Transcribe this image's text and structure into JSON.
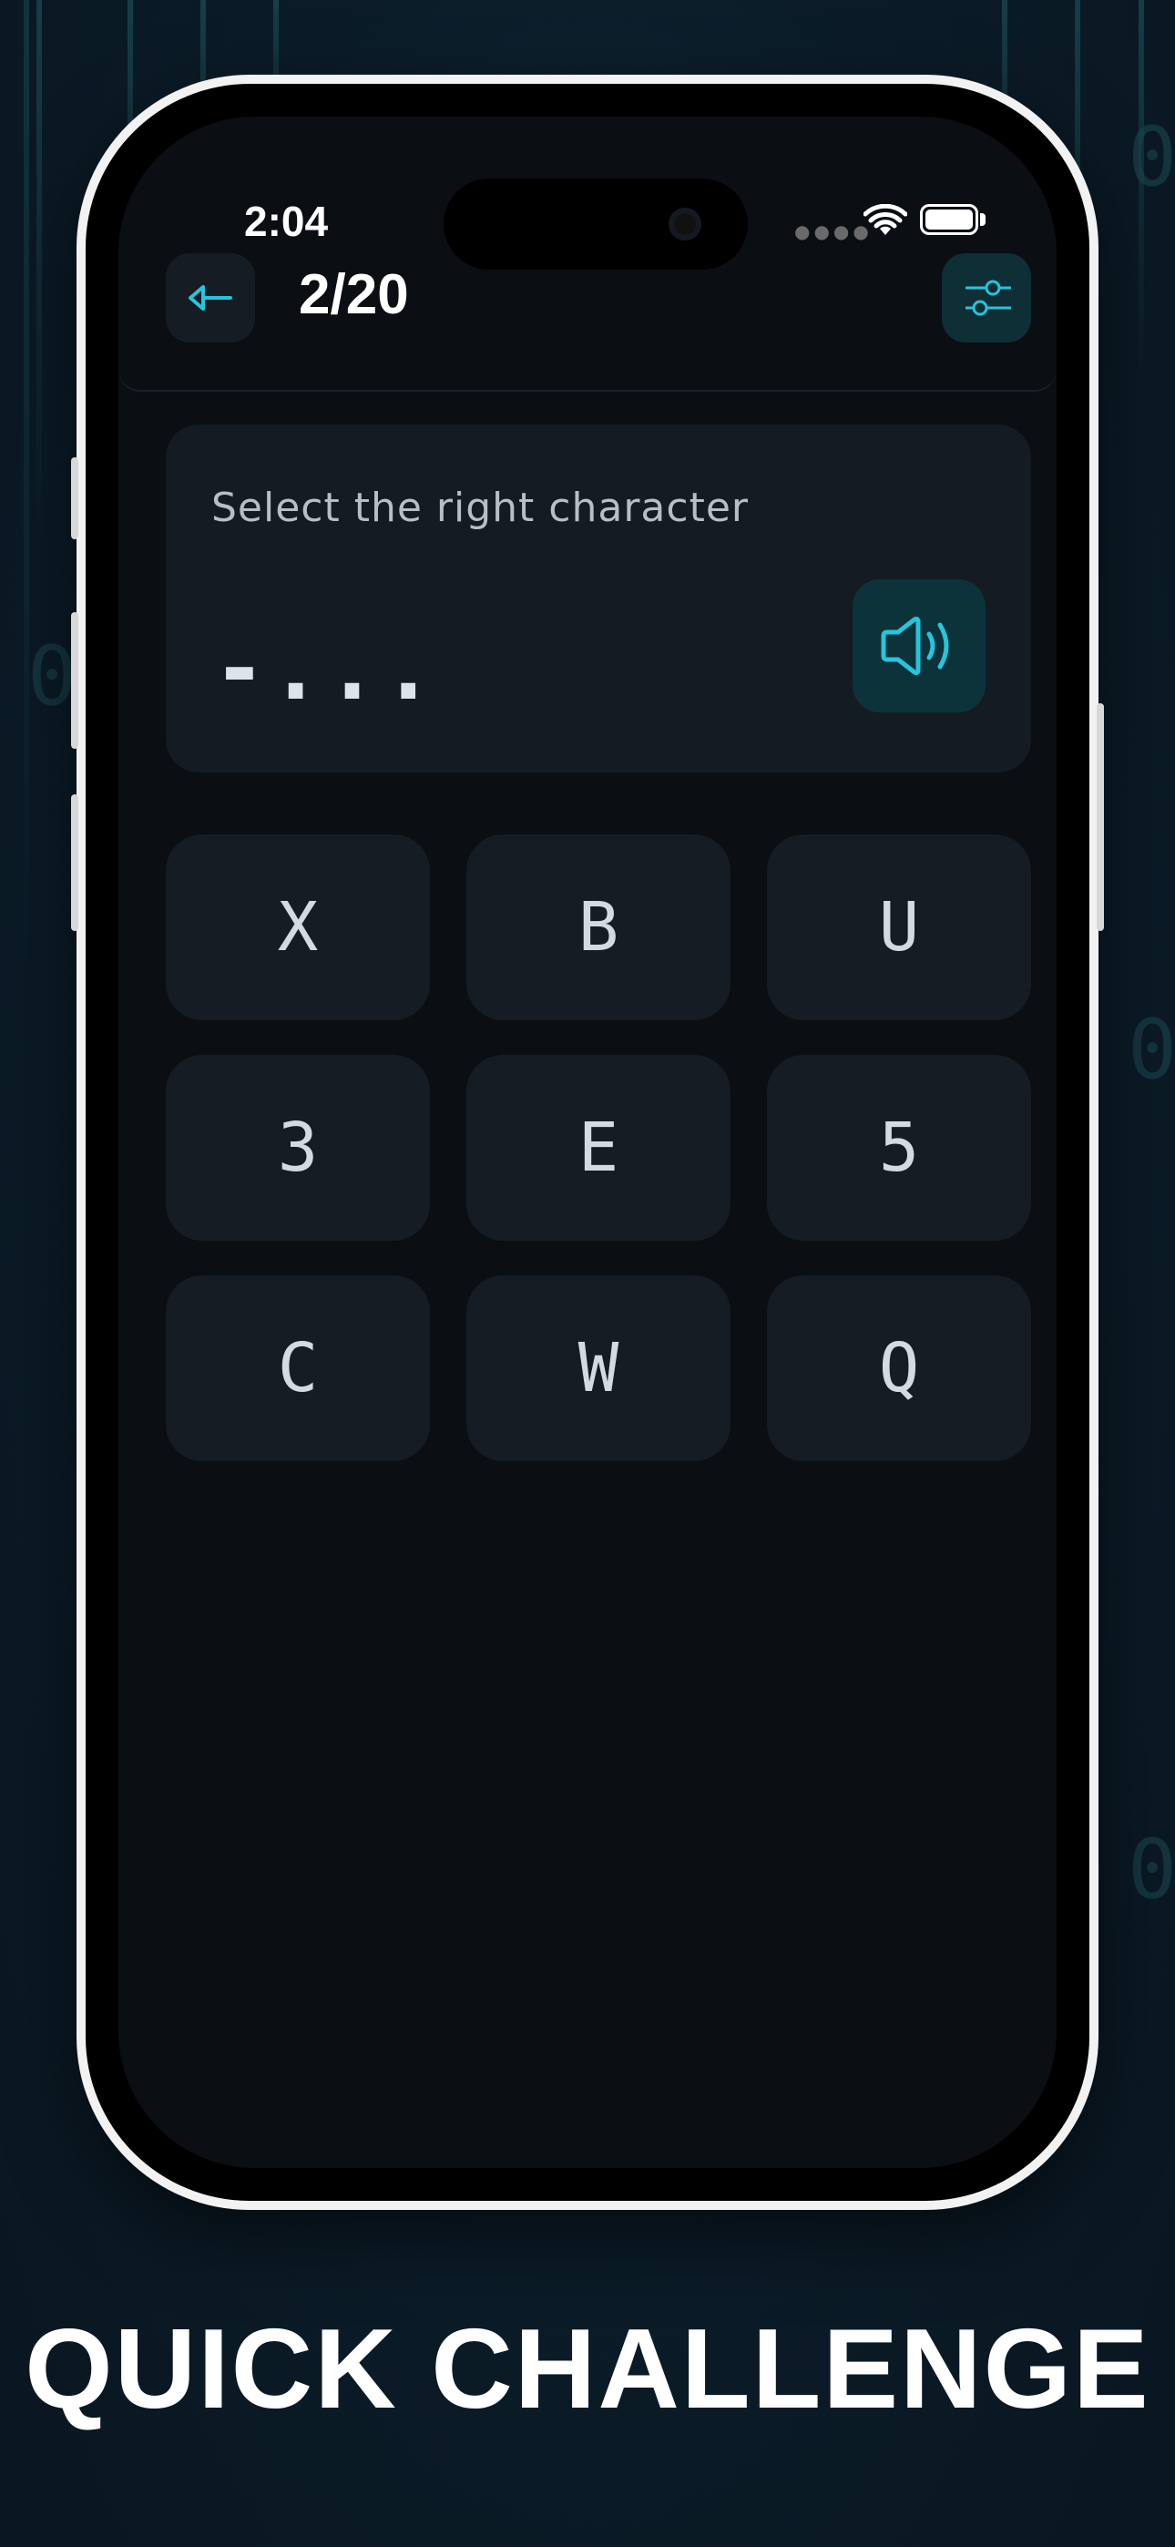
{
  "status_bar": {
    "time": "2:04"
  },
  "header": {
    "progress": "2/20"
  },
  "question": {
    "prompt": "Select the right character",
    "morse_code": "-..."
  },
  "options": [
    "X",
    "B",
    "U",
    "3",
    "E",
    "5",
    "C",
    "W",
    "Q"
  ],
  "footer": {
    "headline": "QUICK CHALLENGE"
  },
  "colors": {
    "accent": "#27c4dc",
    "background": "#0b0e12",
    "card": "#161c24"
  },
  "icons": {
    "back": "arrow-left-icon",
    "settings": "sliders-icon",
    "sound": "speaker-icon"
  }
}
